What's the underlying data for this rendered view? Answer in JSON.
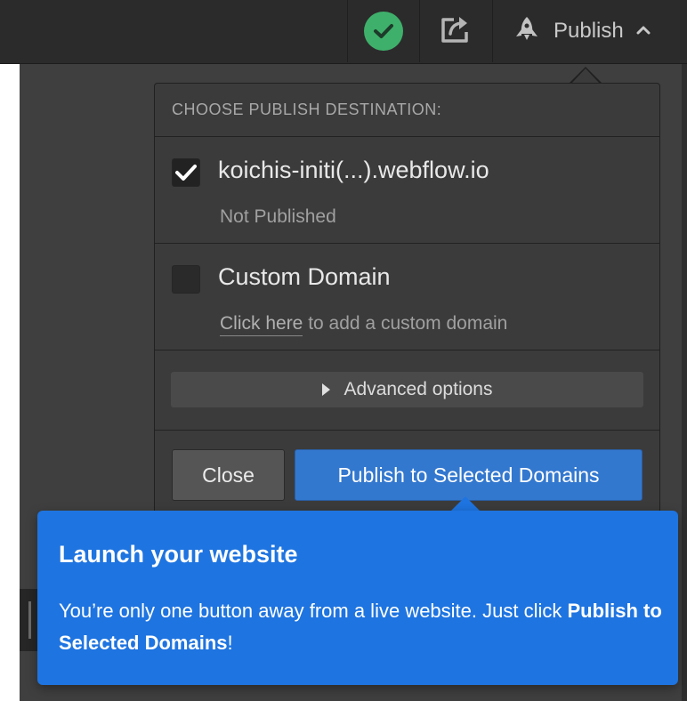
{
  "topbar": {
    "status_icon": "checkmark-circle-icon",
    "status_color": "#3fb06b",
    "share_icon": "export-share-icon",
    "publish_icon": "rocket-icon",
    "publish_label": "Publish",
    "publish_chevron": "chevron-up-icon"
  },
  "panel": {
    "header": "CHOOSE PUBLISH DESTINATION:",
    "destinations": [
      {
        "title": "koichis-initi(...).webflow.io",
        "status": "Not Published",
        "checked": true
      },
      {
        "title": "Custom Domain",
        "link_text": "Click here",
        "sub_text": " to add a custom domain",
        "checked": false
      }
    ],
    "advanced_label": "Advanced options",
    "close_label": "Close",
    "publish_label": "Publish to Selected Domains",
    "publish_color": "#3378cf"
  },
  "tooltip": {
    "title": "Launch your website",
    "body_text": "You’re only one button away from a live website. Just click ",
    "body_bold": "Publish to Selected Domains",
    "body_end": "!",
    "color": "#1e74e0"
  }
}
